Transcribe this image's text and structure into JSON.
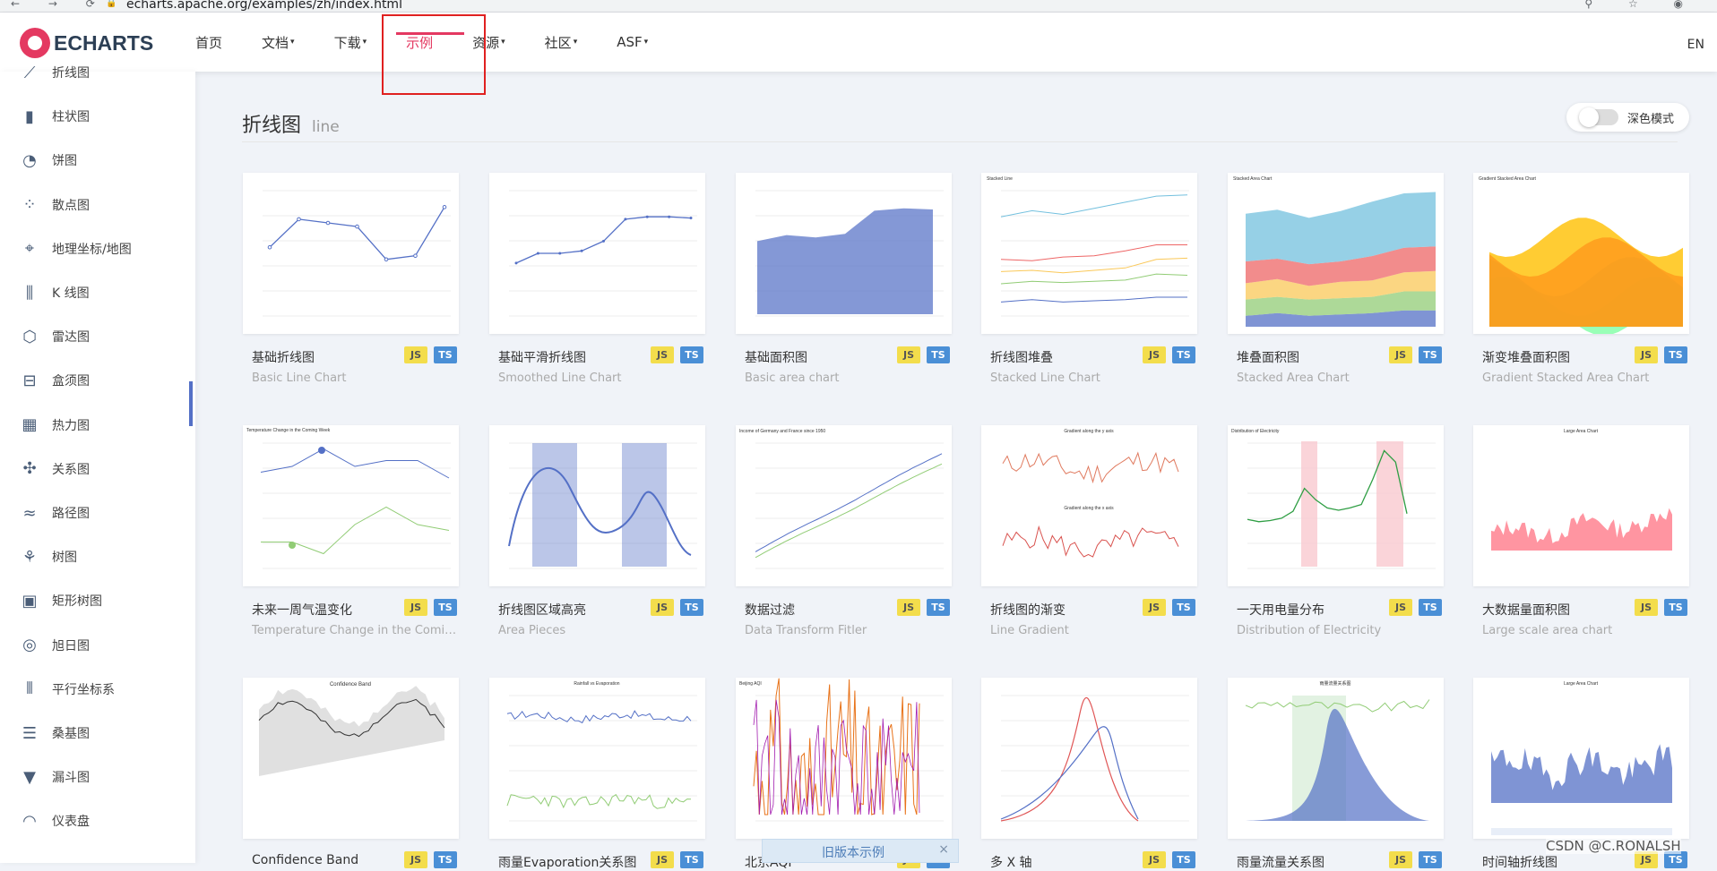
{
  "browser": {
    "url": "echarts.apache.org/examples/zh/index.html",
    "nav_glyphs": "← → ⟳",
    "tool_glyphs": "⚲ ☆ ◉"
  },
  "topnav": {
    "logo_text": "ECHARTS",
    "menu": [
      {
        "label": "首页",
        "caret": ""
      },
      {
        "label": "文档",
        "caret": "▾"
      },
      {
        "label": "下载",
        "caret": "▾"
      },
      {
        "label": "示例",
        "caret": ""
      },
      {
        "label": "资源",
        "caret": "▾"
      },
      {
        "label": "社区",
        "caret": "▾"
      },
      {
        "label": "ASF",
        "caret": "▾"
      }
    ],
    "lang": "EN",
    "active_index": 3
  },
  "sidebar": {
    "items": [
      {
        "label": "折线图",
        "icon": "line-chart-icon",
        "glyph": "⟋"
      },
      {
        "label": "柱状图",
        "icon": "bar-chart-icon",
        "glyph": "▮"
      },
      {
        "label": "饼图",
        "icon": "pie-chart-icon",
        "glyph": "◔"
      },
      {
        "label": "散点图",
        "icon": "scatter-chart-icon",
        "glyph": "⁘"
      },
      {
        "label": "地理坐标/地图",
        "icon": "map-icon",
        "glyph": "⌖"
      },
      {
        "label": "K 线图",
        "icon": "candlestick-icon",
        "glyph": "⫼"
      },
      {
        "label": "雷达图",
        "icon": "radar-icon",
        "glyph": "⬡"
      },
      {
        "label": "盒须图",
        "icon": "boxplot-icon",
        "glyph": "⊟"
      },
      {
        "label": "热力图",
        "icon": "heatmap-icon",
        "glyph": "▦"
      },
      {
        "label": "关系图",
        "icon": "graph-icon",
        "glyph": "✣"
      },
      {
        "label": "路径图",
        "icon": "lines-icon",
        "glyph": "≈"
      },
      {
        "label": "树图",
        "icon": "tree-icon",
        "glyph": "⚘"
      },
      {
        "label": "矩形树图",
        "icon": "treemap-icon",
        "glyph": "▣"
      },
      {
        "label": "旭日图",
        "icon": "sunburst-icon",
        "glyph": "◎"
      },
      {
        "label": "平行坐标系",
        "icon": "parallel-icon",
        "glyph": "⫴"
      },
      {
        "label": "桑基图",
        "icon": "sankey-icon",
        "glyph": "☰"
      },
      {
        "label": "漏斗图",
        "icon": "funnel-icon",
        "glyph": "▼"
      },
      {
        "label": "仪表盘",
        "icon": "gauge-icon",
        "glyph": "◠"
      }
    ]
  },
  "section": {
    "title_cn": "折线图",
    "title_en": "line",
    "dark_mode_label": "深色模式"
  },
  "tags": {
    "js": "JS",
    "ts": "TS"
  },
  "cards": [
    {
      "title": "基础折线图",
      "subtitle": "Basic Line Chart",
      "kind": "line"
    },
    {
      "title": "基础平滑折线图",
      "subtitle": "Smoothed Line Chart",
      "kind": "smooth"
    },
    {
      "title": "基础面积图",
      "subtitle": "Basic area chart",
      "kind": "area"
    },
    {
      "title": "折线图堆叠",
      "subtitle": "Stacked Line Chart",
      "kind": "stacked"
    },
    {
      "title": "堆叠面积图",
      "subtitle": "Stacked Area Chart",
      "kind": "stackedarea"
    },
    {
      "title": "渐变堆叠面积图",
      "subtitle": "Gradient Stacked Area Chart",
      "kind": "gradient"
    },
    {
      "title": "未来一周气温变化",
      "subtitle": "Temperature Change in the Coming Week",
      "kind": "temp"
    },
    {
      "title": "折线图区域高亮",
      "subtitle": "Area Pieces",
      "kind": "pieces"
    },
    {
      "title": "数据过滤",
      "subtitle": "Data Transform Fitler",
      "kind": "filter"
    },
    {
      "title": "折线图的渐变",
      "subtitle": "Line Gradient",
      "kind": "linegrad"
    },
    {
      "title": "一天用电量分布",
      "subtitle": "Distribution of Electricity",
      "kind": "electric"
    },
    {
      "title": "大数据量面积图",
      "subtitle": "Large scale area chart",
      "kind": "large"
    },
    {
      "title": "Confidence Band",
      "subtitle": "",
      "kind": "band"
    },
    {
      "title": "雨量Evaporation关系图",
      "subtitle": "",
      "kind": "rain"
    },
    {
      "title": "北京AQI",
      "subtitle": "",
      "kind": "aqi"
    },
    {
      "title": "多 X 轴",
      "subtitle": "",
      "kind": "multix"
    },
    {
      "title": "雨量流量关系图",
      "subtitle": "",
      "kind": "flow"
    },
    {
      "title": "时间轴折线图",
      "subtitle": "",
      "kind": "timeline"
    }
  ],
  "thumb_text": {
    "stacked": "Stacked Line",
    "stackedarea": "Stacked Area Chart",
    "gradient": "Gradient Stacked Area Chart",
    "temp": "Temperature Change in the Coming Week",
    "filter": "Income of Germany and France since 1950",
    "linegrad_a": "Gradient along the y axis",
    "linegrad_b": "Gradient along the x axis",
    "electric": "Distribution of Electricity",
    "large": "Large Area Chart",
    "band": "Confidence Band",
    "rain": "Rainfall vs Evaporation",
    "aqi": "Beijing AQI",
    "flow": "雨量流量关系图",
    "timeline": "Large Area Chart"
  },
  "old_version": {
    "label": "旧版本示例",
    "close": "×"
  },
  "credit": "CSDN @C.RONALSH",
  "colors": {
    "accent": "#e43961",
    "blue": "#5470c6",
    "green": "#91cc75",
    "yellow": "#fac858",
    "red": "#ee6666",
    "cyan": "#73c0de"
  }
}
